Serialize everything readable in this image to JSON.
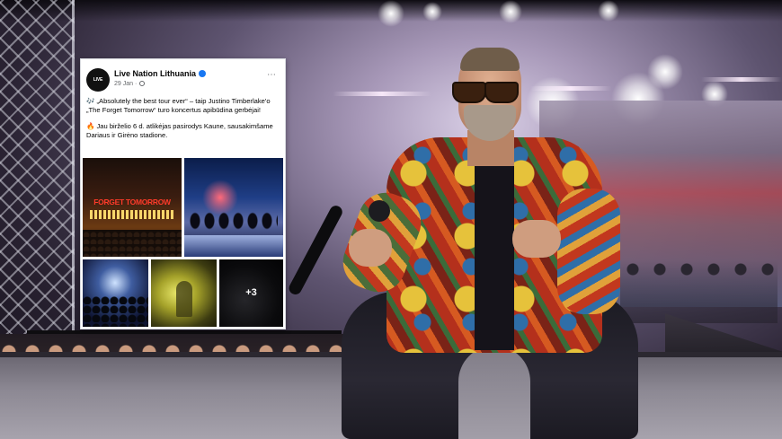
{
  "post": {
    "page_name": "Live Nation Lithuania",
    "avatar_text": "LIVE NATION",
    "date": "29 Jan ·",
    "paragraph_1": "„Absolutely the best tour ever“ – taip Justino Timberlake'o „The Forget Tomorrow“ turo koncertus apibūdina gerbėjai!",
    "paragraph_1_emoji": "🎶",
    "paragraph_2": "Jau birželio 6 d. atlikėjas pasirodys Kaune, sausakimšame Dariaus ir Girėno stadione.",
    "paragraph_2_emoji": "🔥",
    "more_icon": "⋯",
    "photos": {
      "photo_1_text": "FORGET TOMORROW",
      "more_count": "+3"
    }
  },
  "icons": [
    "verified-icon",
    "globe-icon",
    "more-options-icon",
    "music-notes-icon",
    "fire-icon"
  ],
  "colors": {
    "verified": "#1877f2",
    "card_bg": "#ffffff",
    "text_primary": "#050505",
    "text_secondary": "#65676b",
    "jacket_red": "#b4301c"
  }
}
